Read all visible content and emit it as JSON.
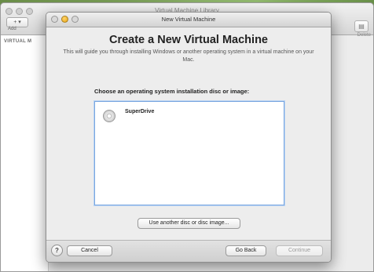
{
  "library_window": {
    "title": "Virtual Machine Library",
    "add_button": "+ ▾",
    "add_label": "Add",
    "delete_label": "Delete",
    "sidebar_header": "VIRTUAL M"
  },
  "dialog": {
    "title": "New Virtual Machine",
    "heading": "Create a New Virtual Machine",
    "subtitle": "This will guide you through installing Windows or another operating system in a virtual machine on your Mac.",
    "choose_label": "Choose an operating system installation disc or image:",
    "items": [
      {
        "label": "SuperDrive",
        "icon": "disc-icon"
      }
    ],
    "use_another_button": "Use another disc or disc image...",
    "help_button": "?",
    "cancel_button": "Cancel",
    "go_back_button": "Go Back",
    "continue_button": "Continue"
  }
}
